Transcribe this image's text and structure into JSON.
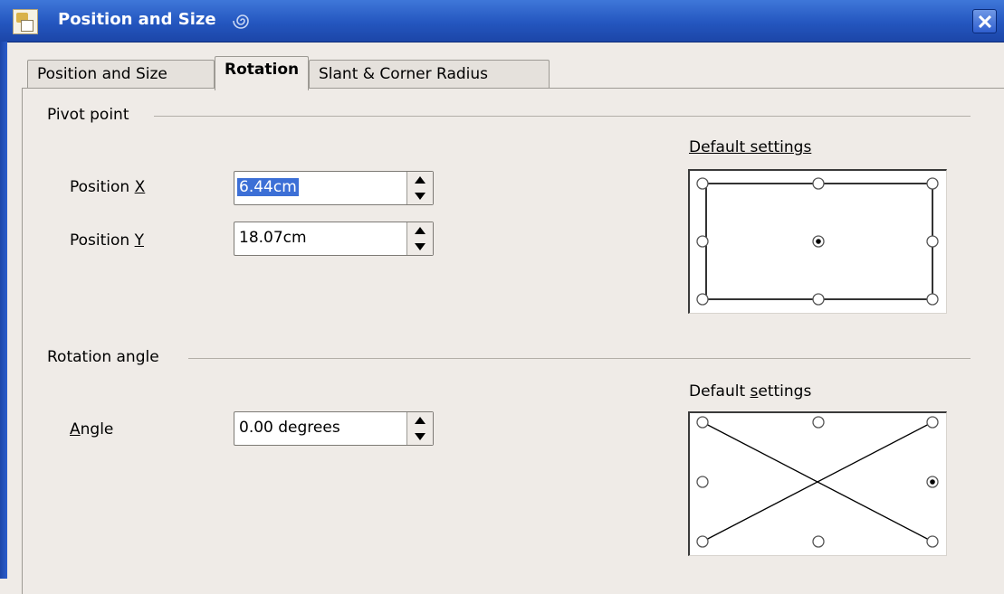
{
  "window": {
    "title": "Position and Size",
    "icon": "app-icon",
    "close_icon": "close-icon"
  },
  "tabs": [
    {
      "label": "Position and Size",
      "active": false
    },
    {
      "label": "Rotation",
      "active": true
    },
    {
      "label": "Slant & Corner Radius",
      "active": false
    }
  ],
  "pivot": {
    "section_label": "Pivot point",
    "default_settings_label": "Default settings",
    "position_x": {
      "label_prefix": "Position ",
      "label_accel": "X",
      "value": "6.44cm"
    },
    "position_y": {
      "label_prefix": "Position ",
      "label_accel": "Y",
      "value": "18.07cm"
    },
    "selected_point": "center"
  },
  "rotation": {
    "section_label": "Rotation angle",
    "default_settings_label_prefix": "Default ",
    "default_settings_label_accel": "s",
    "default_settings_label_suffix": "ettings",
    "angle": {
      "label_accel": "A",
      "label_rest": "ngle",
      "value": "0.00 degrees"
    },
    "selected_point": "right-middle"
  },
  "colors": {
    "titlebar": "#2456bf",
    "dialog_bg": "#efebe7",
    "selection": "#3c6fd6"
  }
}
